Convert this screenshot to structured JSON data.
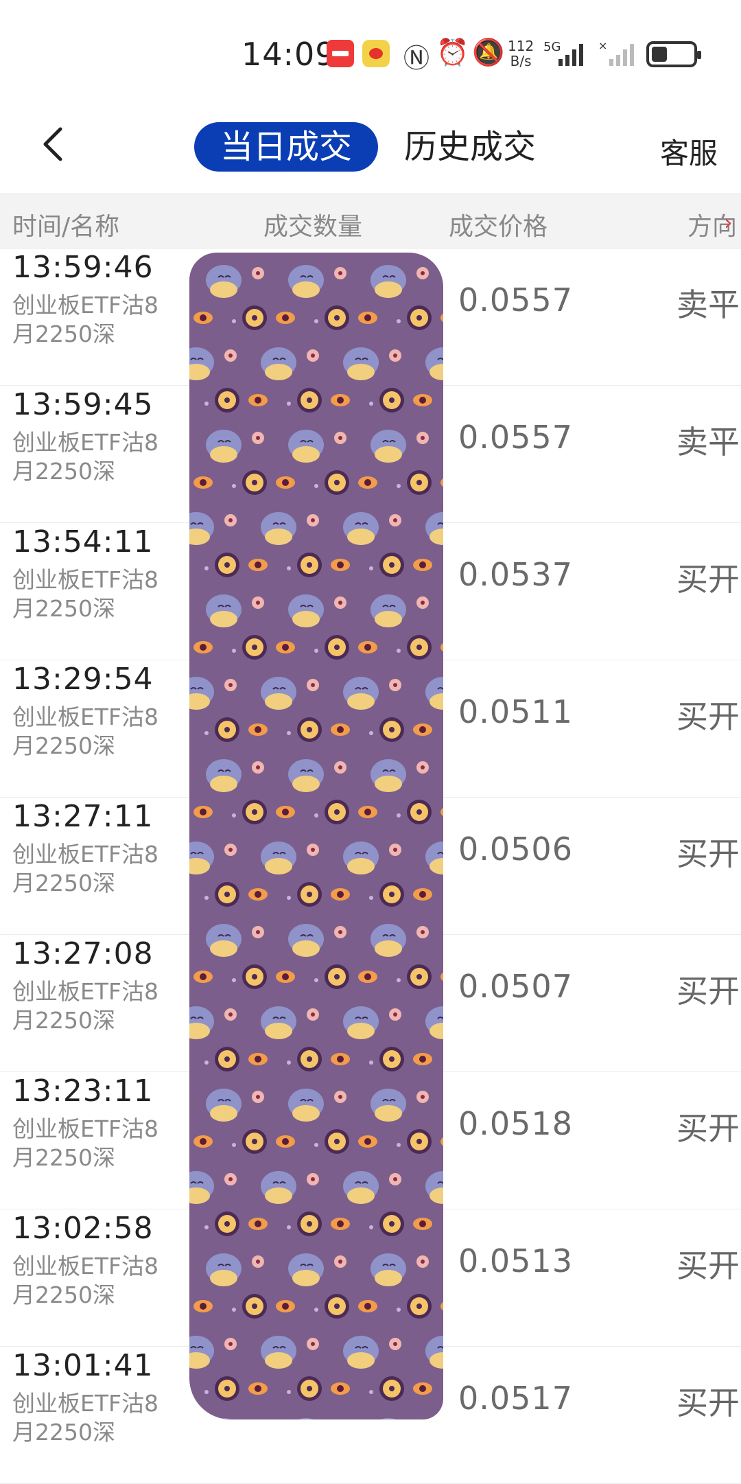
{
  "status_bar": {
    "time": "14:09",
    "net_speed_top": "112",
    "net_speed_bottom": "B/s",
    "network_label": "5G"
  },
  "header": {
    "tab_today": "当日成交",
    "tab_history": "历史成交",
    "service": "客服"
  },
  "table_header": {
    "time_name": "时间/名称",
    "quantity": "成交数量",
    "price": "成交价格",
    "direction": "方向"
  },
  "rows": [
    {
      "time": "13:59:46",
      "name": "创业板ETF沽8月2250深",
      "price": "0.0557",
      "direction": "卖平"
    },
    {
      "time": "13:59:45",
      "name": "创业板ETF沽8月2250深",
      "price": "0.0557",
      "direction": "卖平"
    },
    {
      "time": "13:54:11",
      "name": "创业板ETF沽8月2250深",
      "price": "0.0537",
      "direction": "买开"
    },
    {
      "time": "13:29:54",
      "name": "创业板ETF沽8月2250深",
      "price": "0.0511",
      "direction": "买开"
    },
    {
      "time": "13:27:11",
      "name": "创业板ETF沽8月2250深",
      "price": "0.0506",
      "direction": "买开"
    },
    {
      "time": "13:27:08",
      "name": "创业板ETF沽8月2250深",
      "price": "0.0507",
      "direction": "买开"
    },
    {
      "time": "13:23:11",
      "name": "创业板ETF沽8月2250深",
      "price": "0.0518",
      "direction": "买开"
    },
    {
      "time": "13:02:58",
      "name": "创业板ETF沽8月2250深",
      "price": "0.0513",
      "direction": "买开"
    },
    {
      "time": "13:01:41",
      "name": "创业板ETF沽8月2250深",
      "price": "0.0517",
      "direction": "买开"
    }
  ],
  "colors": {
    "accent": "#0b3eb5",
    "overlay": "#7b5e8c",
    "arrow": "#e0403a"
  }
}
